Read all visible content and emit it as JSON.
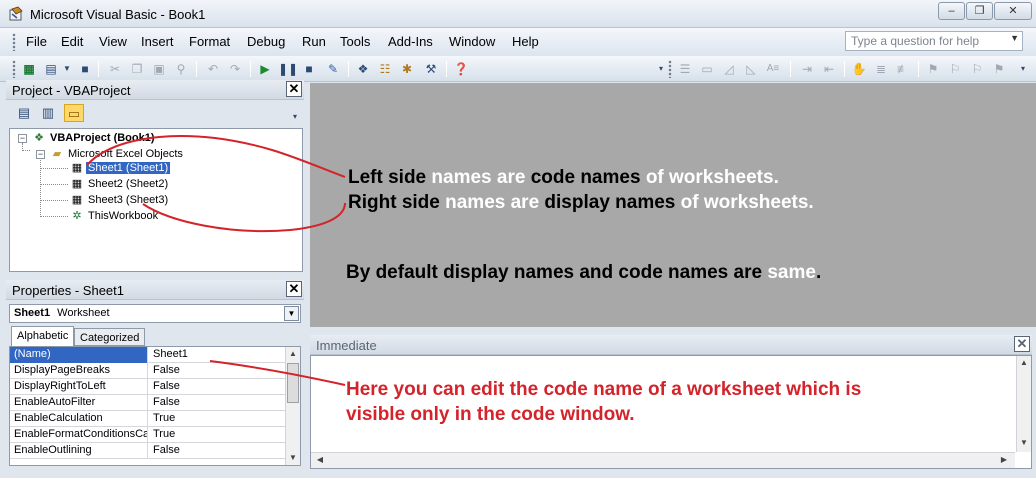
{
  "window": {
    "title": "Microsoft Visual Basic - Book1",
    "controls": {
      "minimize": "–",
      "restore": "❐",
      "close": "✕"
    }
  },
  "menu": {
    "items": [
      "File",
      "Edit",
      "View",
      "Insert",
      "Format",
      "Debug",
      "Run",
      "Tools",
      "Add-Ins",
      "Window",
      "Help"
    ],
    "help_placeholder": "Type a question for help"
  },
  "project": {
    "title": "Project - VBAProject",
    "close": "✕",
    "tree": {
      "root": "VBAProject (Book1)",
      "folder": "Microsoft Excel Objects",
      "items": [
        "Sheet1 (Sheet1)",
        "Sheet2 (Sheet2)",
        "Sheet3 (Sheet3)",
        "ThisWorkbook"
      ]
    }
  },
  "properties": {
    "title": "Properties - Sheet1",
    "close": "✕",
    "object_name": "Sheet1",
    "object_type": "Worksheet",
    "tabs": [
      "Alphabetic",
      "Categorized"
    ],
    "rows": [
      {
        "name": "(Name)",
        "value": "Sheet1"
      },
      {
        "name": "DisplayPageBreaks",
        "value": "False"
      },
      {
        "name": "DisplayRightToLeft",
        "value": "False"
      },
      {
        "name": "EnableAutoFilter",
        "value": "False"
      },
      {
        "name": "EnableCalculation",
        "value": "True"
      },
      {
        "name": "EnableFormatConditionsCalculation",
        "value": "True"
      },
      {
        "name": "EnableOutlining",
        "value": "False"
      }
    ]
  },
  "annotations": {
    "line1": {
      "a": "Left side ",
      "b": "names are ",
      "c": "code names ",
      "d": "of worksheets."
    },
    "line2": {
      "a": "Right side ",
      "b": "names are ",
      "c": "display names ",
      "d": "of worksheets."
    },
    "line3": {
      "a": "By default display names and code names are ",
      "b": "same",
      "c": "."
    },
    "line4": "Here you can edit the code name of a worksheet which is",
    "line5": "visible only in the code window."
  },
  "immediate": {
    "title": "Immediate",
    "close": "✕"
  },
  "colors": {
    "annotation_red": "#d4232a",
    "selection_blue": "#3166c3",
    "code_area_gray": "#a8a8a8"
  }
}
